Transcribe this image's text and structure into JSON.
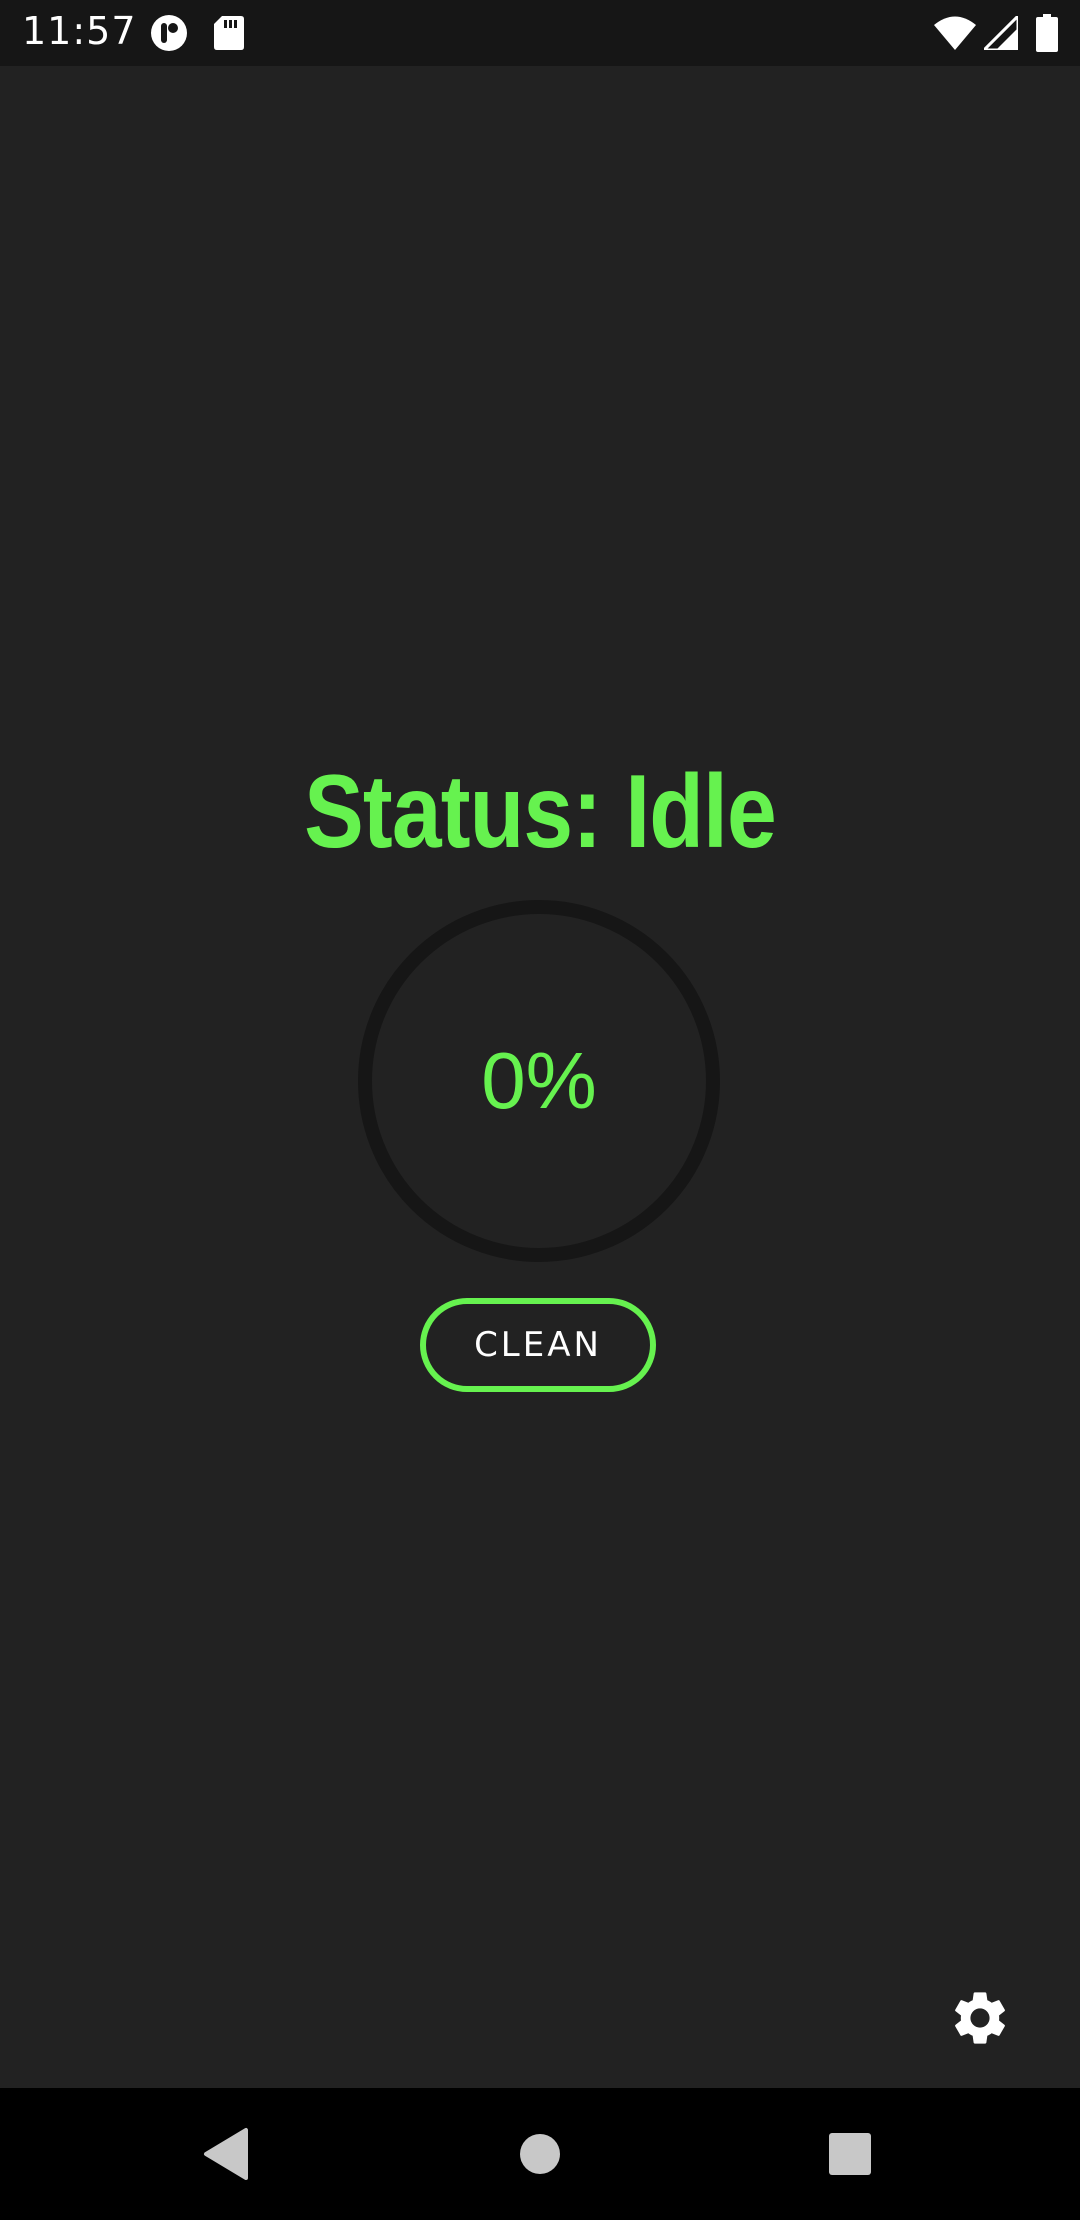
{
  "status_bar": {
    "time": "11:57",
    "icons": [
      "app-notification-icon",
      "sd-card-icon",
      "wifi-icon",
      "cellular-signal-icon",
      "battery-icon"
    ]
  },
  "main": {
    "status_title": "Status: Idle",
    "progress": {
      "label": "0%",
      "value": 0
    },
    "clean_button_label": "CLEAN",
    "settings_icon": "gear-icon"
  },
  "nav_bar": {
    "buttons": [
      "back-icon",
      "home-icon",
      "recents-icon"
    ]
  },
  "colors": {
    "accent": "#66f24f",
    "background": "#222222",
    "status_bar": "#161616",
    "ring_track": "#161616",
    "nav_bar": "#000000"
  }
}
